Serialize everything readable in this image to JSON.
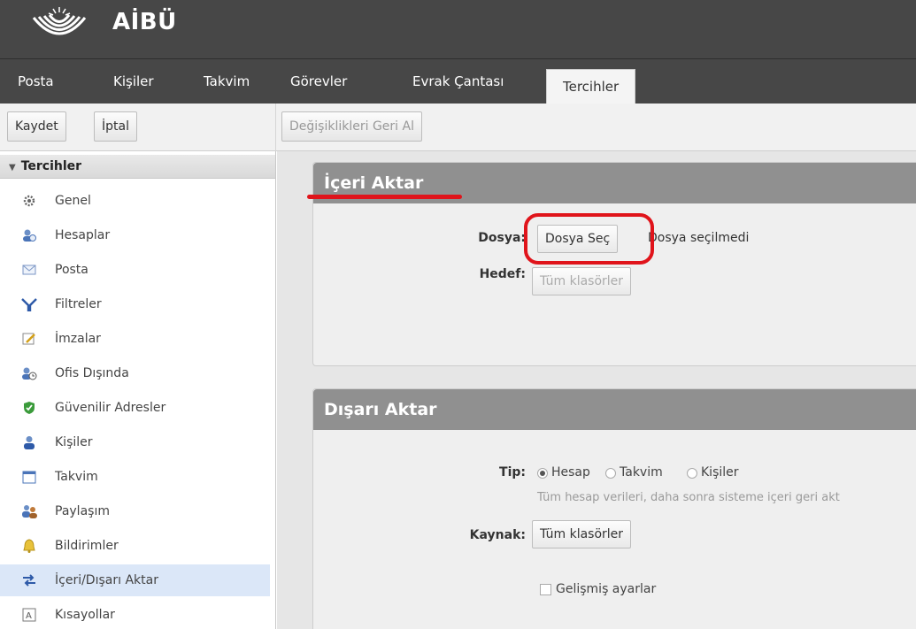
{
  "app": {
    "name": "AİBÜ"
  },
  "nav": {
    "tabs": [
      {
        "label": "Posta"
      },
      {
        "label": "Kişiler"
      },
      {
        "label": "Takvim"
      },
      {
        "label": "Görevler"
      },
      {
        "label": "Evrak Çantası"
      },
      {
        "label": "Tercihler",
        "active": true
      }
    ]
  },
  "toolbar": {
    "save_label": "Kaydet",
    "cancel_label": "İptal",
    "revert_label": "Değişiklikleri Geri Al"
  },
  "sidebar": {
    "header": "Tercihler",
    "items": [
      {
        "label": "Genel",
        "icon": "gear-icon"
      },
      {
        "label": "Hesaplar",
        "icon": "accounts-icon"
      },
      {
        "label": "Posta",
        "icon": "mail-icon"
      },
      {
        "label": "Filtreler",
        "icon": "filter-icon"
      },
      {
        "label": "İmzalar",
        "icon": "signature-icon"
      },
      {
        "label": "Ofis Dışında",
        "icon": "out-of-office-icon"
      },
      {
        "label": "Güvenilir Adresler",
        "icon": "shield-icon"
      },
      {
        "label": "Kişiler",
        "icon": "contact-icon"
      },
      {
        "label": "Takvim",
        "icon": "calendar-icon"
      },
      {
        "label": "Paylaşım",
        "icon": "sharing-icon"
      },
      {
        "label": "Bildirimler",
        "icon": "bell-icon"
      },
      {
        "label": "İçeri/Dışarı Aktar",
        "icon": "import-export-icon",
        "selected": true
      },
      {
        "label": "Kısayollar",
        "icon": "shortcut-icon"
      }
    ]
  },
  "import": {
    "title": "İçeri Aktar",
    "file_label": "Dosya:",
    "choose_file_label": "Dosya Seç",
    "no_file_text": "Dosya seçilmedi",
    "target_label": "Hedef:",
    "target_button": "Tüm klasörler"
  },
  "export": {
    "title": "Dışarı Aktar",
    "type_label": "Tip:",
    "type_options": [
      {
        "label": "Hesap",
        "checked": true
      },
      {
        "label": "Takvim",
        "checked": false
      },
      {
        "label": "Kişiler",
        "checked": false
      }
    ],
    "type_note": "Tüm hesap verileri, daha sonra sisteme içeri geri akt",
    "source_label": "Kaynak:",
    "source_button": "Tüm klasörler",
    "advanced_label": "Gelişmiş ayarlar"
  },
  "colors": {
    "header_bg": "#474747",
    "panel_head_bg": "#909090",
    "annotation_red": "#e0141b",
    "selected_row": "#dbe7f8"
  }
}
